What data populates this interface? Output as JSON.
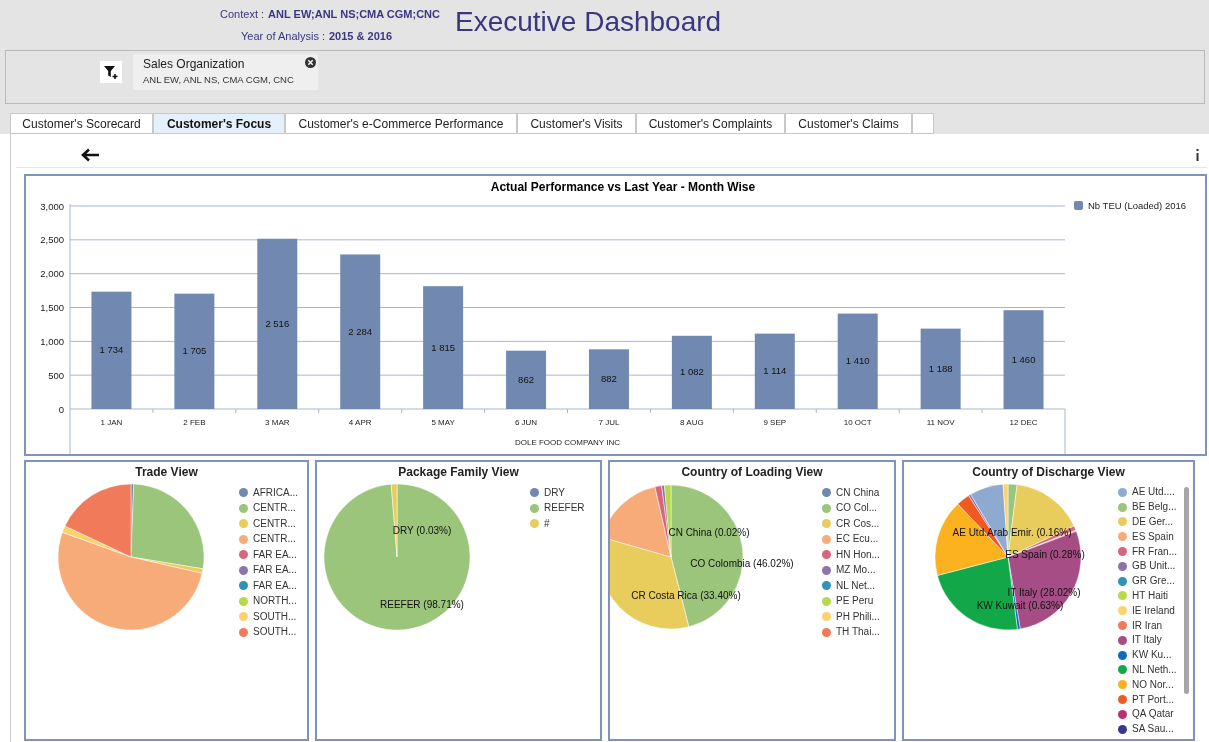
{
  "header": {
    "context_label": "Context :",
    "context_value": "ANL EW;ANL NS;CMA CGM;CNC",
    "year_label": "Year of Analysis :",
    "year_value": "2015 & 2016",
    "title": "Executive Dashboard"
  },
  "filter": {
    "chip_title": "Sales Organization",
    "chip_value": "ANL EW, ANL NS, CMA CGM, CNC"
  },
  "tabs": [
    {
      "label": "Customer's Scorecard",
      "selected": false
    },
    {
      "label": "Customer's Focus",
      "selected": true
    },
    {
      "label": "Customer's e-Commerce Performance",
      "selected": false
    },
    {
      "label": "Customer's Visits",
      "selected": false
    },
    {
      "label": "Customer's Complaints",
      "selected": false
    },
    {
      "label": "Customer's Claims",
      "selected": false
    }
  ],
  "bar_panel": {
    "chart_data": {
      "type": "bar",
      "title": "Actual Performance vs Last Year - Month Wise",
      "xlabel": "DOLE FOOD COMPANY INC",
      "categories": [
        "1 JAN",
        "2 FEB",
        "3 MAR",
        "4 APR",
        "5 MAY",
        "6 JUN",
        "7 JUL",
        "8 AUG",
        "9 SEP",
        "10 OCT",
        "11 NOV",
        "12 DEC"
      ],
      "series": [
        {
          "name": "Nb TEU (Loaded) 2016",
          "color": "#7189b0",
          "values": [
            1734,
            1705,
            2516,
            2284,
            1815,
            862,
            882,
            1082,
            1114,
            1410,
            1188,
            1460
          ]
        }
      ],
      "ylim": [
        0,
        3000
      ],
      "yticks": [
        {
          "value": 0,
          "label": "0"
        },
        {
          "value": 500,
          "label": "500"
        },
        {
          "value": 1000,
          "label": "1,000"
        },
        {
          "value": 1500,
          "label": "1,500"
        },
        {
          "value": 2000,
          "label": "2,000"
        },
        {
          "value": 2500,
          "label": "2,500"
        },
        {
          "value": 3000,
          "label": "3,000"
        }
      ],
      "grid": true,
      "value_labels": [
        "1 734",
        "1 705",
        "2 516",
        "2 284",
        "1 815",
        "862",
        "882",
        "1 082",
        "1 114",
        "1 410",
        "1 188",
        "1 460"
      ]
    }
  },
  "pie_panels": [
    {
      "title": "Trade View",
      "legend": [
        {
          "label": "AFRICA...",
          "color": "#7189b0"
        },
        {
          "label": "CENTR...",
          "color": "#9bc57a"
        },
        {
          "label": "CENTR...",
          "color": "#e8cd5c"
        },
        {
          "label": "CENTR...",
          "color": "#f6ab78"
        },
        {
          "label": "FAR EA...",
          "color": "#d6677a"
        },
        {
          "label": "FAR EA...",
          "color": "#8d73a8"
        },
        {
          "label": "FAR EA...",
          "color": "#2f93b5"
        },
        {
          "label": "NORTH...",
          "color": "#b8d94a"
        },
        {
          "label": "SOUTH...",
          "color": "#fcd36a"
        },
        {
          "label": "SOUTH...",
          "color": "#f07a5a"
        }
      ]
    },
    {
      "title": "Package Family View",
      "legend": [
        {
          "label": "DRY",
          "color": "#7189b0"
        },
        {
          "label": "REEFER",
          "color": "#9bc57a"
        },
        {
          "label": "#",
          "color": "#e8cd5c"
        }
      ],
      "slice_labels": [
        "DRY (0.03%)",
        "REEFER (98.71%)"
      ]
    },
    {
      "title": "Country of Loading View",
      "legend": [
        {
          "label": "CN China",
          "color": "#7189b0"
        },
        {
          "label": "CO Col...",
          "color": "#9bc57a"
        },
        {
          "label": "CR Cos...",
          "color": "#e8cd5c"
        },
        {
          "label": "EC Ecu...",
          "color": "#f6ab78"
        },
        {
          "label": "HN Hon...",
          "color": "#d6677a"
        },
        {
          "label": "MZ Mo...",
          "color": "#8d73a8"
        },
        {
          "label": "NL Net...",
          "color": "#2f93b5"
        },
        {
          "label": "PE Peru",
          "color": "#b8d94a"
        },
        {
          "label": "PH Phili...",
          "color": "#fcd36a"
        },
        {
          "label": "TH Thai...",
          "color": "#f07a5a"
        }
      ],
      "slice_labels": [
        "CN China (0.02%)",
        "CO Colombia (46.02%)",
        "CR Costa Rica (33.40%)"
      ]
    },
    {
      "title": "Country of Discharge View",
      "legend": [
        {
          "label": "AE Utd....",
          "color": "#8faad0"
        },
        {
          "label": "BE Belg...",
          "color": "#9bc57a"
        },
        {
          "label": "DE Ger...",
          "color": "#e8cd5c"
        },
        {
          "label": "ES Spain",
          "color": "#f6ab78"
        },
        {
          "label": "FR Fran...",
          "color": "#d6677a"
        },
        {
          "label": "GB Unit...",
          "color": "#8d73a8"
        },
        {
          "label": "GR Gre...",
          "color": "#2f93b5"
        },
        {
          "label": "HT Haiti",
          "color": "#b8d94a"
        },
        {
          "label": "IE Ireland",
          "color": "#fcd36a"
        },
        {
          "label": "IR Iran",
          "color": "#f07a5a"
        },
        {
          "label": "IT Italy",
          "color": "#a64d85"
        },
        {
          "label": "KW Ku...",
          "color": "#0d6cc0"
        },
        {
          "label": "NL Neth...",
          "color": "#12a84a"
        },
        {
          "label": "NO Nor...",
          "color": "#fbb21e"
        },
        {
          "label": "PT Port...",
          "color": "#f05a22"
        },
        {
          "label": "QA Qatar",
          "color": "#b83077"
        },
        {
          "label": "SA Sau...",
          "color": "#3a3593"
        }
      ],
      "slice_labels": [
        "AE Utd.Arab Emir. (0.16%)",
        "ES Spain (0.28%)",
        "IT Italy (28.02%)",
        "KW Kuwait (0.63%)"
      ]
    }
  ]
}
